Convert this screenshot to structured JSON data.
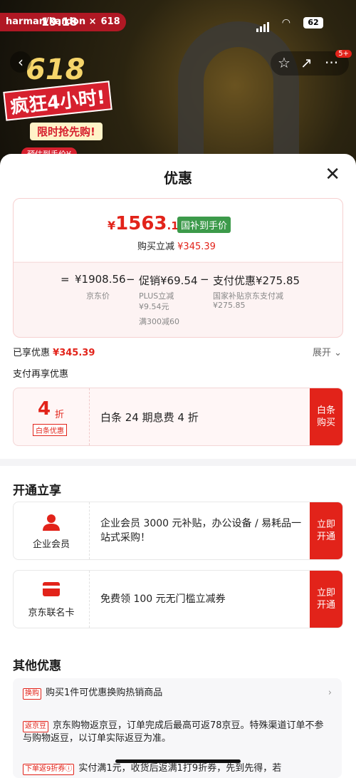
{
  "status": {
    "brand": "harman/kardon",
    "brand_x": "×",
    "brand_618": "618",
    "time": "19:18",
    "battery": "62"
  },
  "banner": {
    "big618": "618",
    "crazy": "疯狂4小时!",
    "limit": "限时抢先购!",
    "presale": "预估到手价¥"
  },
  "top_actions": {
    "badge": "5+"
  },
  "sheet": {
    "title": "优惠",
    "price": {
      "currency": "¥",
      "integer": "1563",
      "decimal": ".17",
      "tag": "国补到手价",
      "buy_reduce_label": "购买立减",
      "buy_reduce_value": "¥345.39"
    },
    "formula": {
      "eq": "=",
      "jd_price": "¥1908.56",
      "jd_price_label": "京东价",
      "minus1": "−",
      "promo": "促销¥69.54",
      "plus_label": "PLUS立减",
      "plus_value": "¥9.54元",
      "full_reduce": "满300减60",
      "minus2": "−",
      "pay": "支付优惠¥275.85",
      "pay_label": "国家补贴京东支付减",
      "pay_value": "¥275.85"
    },
    "enjoyed_label": "已享优惠",
    "enjoyed_value": "¥345.39",
    "expand": "展开",
    "pay_more": "支付再享优惠",
    "baitiao": {
      "num": "4",
      "unit": "折",
      "tag": "白条优惠",
      "desc": "白条 24 期息费 4 折",
      "btn": "白条购买"
    }
  },
  "open_section": {
    "title": "开通立享",
    "cards": [
      {
        "name": "企业会员",
        "desc": "企业会员 3000 元补贴，办公设备 / 易耗品一站式采购！",
        "btn": "立即开通"
      },
      {
        "name": "京东联名卡",
        "desc": "免费领 100 元无门槛立减券",
        "btn": "立即开通"
      }
    ]
  },
  "other_section": {
    "title": "其他优惠",
    "items": [
      {
        "tag": "换购",
        "text": "购买1件可优惠换购热销商品"
      },
      {
        "tag": "返京豆",
        "text": "京东购物返京豆，订单完成后最高可返78京豆。特殊渠道订单不参与购物返豆，以订单实际返豆为准。"
      },
      {
        "tag": "下单返9折券ⓘ",
        "text": "实付满1元，收货后返满1打9折券，先到先得，若"
      }
    ]
  },
  "colors": {
    "accent": "#e2231a",
    "green_tag": "#3c9a4a"
  }
}
